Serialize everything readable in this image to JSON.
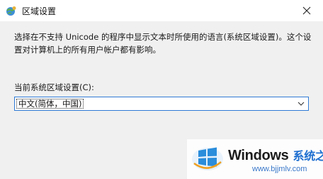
{
  "window": {
    "title": "区域设置",
    "icon": "globe-settings-icon"
  },
  "description": "选择在不支持 Unicode 的程序中显示文本时所使用的语言(系统区域设置)。这个设置对计算机上的所有用户帐户都有影响。",
  "locale": {
    "label": "当前系统区域设置(C):",
    "selected": "中文(简体，中国)"
  },
  "watermark": {
    "brand": "Windows",
    "brand_cn": "系统之家",
    "url": "www.bjjmlv.com"
  },
  "colors": {
    "accent": "#2f7bd6",
    "body_bg": "#f0f0f0",
    "title_bg": "#ffffff"
  }
}
